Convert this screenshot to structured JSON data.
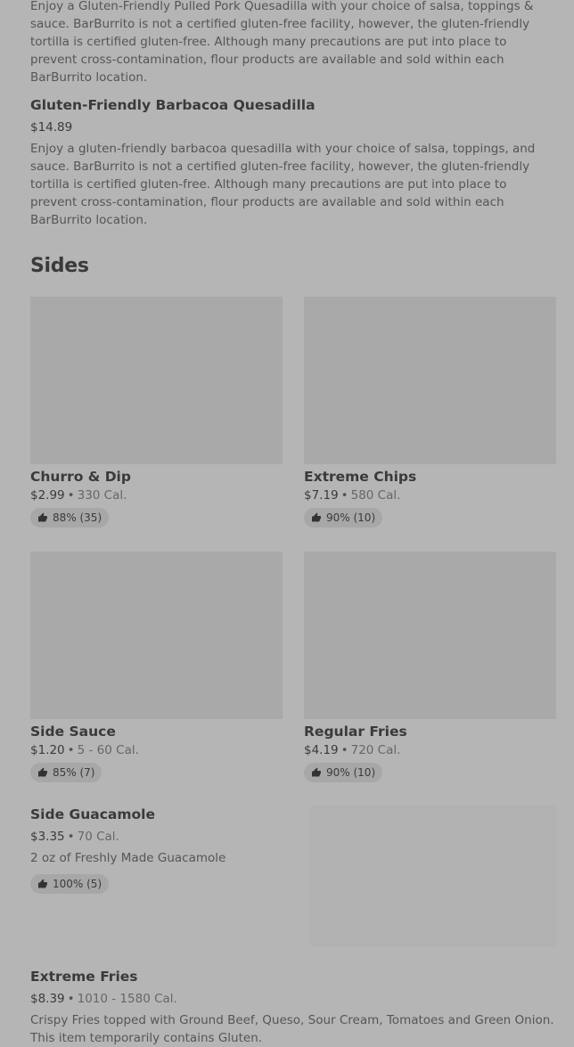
{
  "top_item": {
    "desc": "Enjoy a Gluten-Friendly Pulled Pork Quesadilla with your choice of salsa, toppings & sauce. BarBurrito is not a certified gluten-free facility, however, the gluten-friendly tortilla is certified gluten-free. Although many precautions are put into place to prevent cross-contamination, flour products are available and sold within each BarBurrito location."
  },
  "barbacoa": {
    "title": "Gluten-Friendly Barbacoa Quesadilla",
    "price": "$14.89",
    "desc": "Enjoy a gluten-friendly barbacoa quesadilla with your choice of salsa, toppings, and sauce. BarBurrito is not a certified gluten-free facility, however, the gluten-friendly tortilla is certified gluten-free. Although many precautions are put into place to prevent cross-contamination, flour products are available and sold within each BarBurrito location."
  },
  "sides": {
    "title": "Sides",
    "separator": "•",
    "cards": [
      {
        "name": "Churro & Dip",
        "price": "$2.99",
        "cal": "330 Cal.",
        "rating": "88% (35)"
      },
      {
        "name": "Extreme Chips",
        "price": "$7.19",
        "cal": "580 Cal.",
        "rating": "90% (10)"
      },
      {
        "name": "Side Sauce",
        "price": "$1.20",
        "cal": "5 - 60 Cal.",
        "rating": "85% (7)"
      },
      {
        "name": "Regular Fries",
        "price": "$4.19",
        "cal": "720 Cal.",
        "rating": "90% (10)"
      }
    ],
    "guac": {
      "name": "Side Guacamole",
      "price": "$3.35",
      "cal": "70 Cal.",
      "desc": "2 oz of Freshly Made Guacamole",
      "rating": "100% (5)"
    },
    "extreme_fries": {
      "name": "Extreme Fries",
      "price": "$8.39",
      "cal": "1010 - 1580 Cal.",
      "desc": "Crispy Fries topped with Ground Beef, Queso, Sour Cream, Tomatoes and Green Onion. This item temporarily contains Gluten."
    }
  },
  "colors": {
    "background": "#b5b5b5",
    "image_placeholder": "#a9a9a9",
    "badge": "#a7a7a7"
  },
  "icons": {
    "rating": "thumbs-up-icon"
  }
}
